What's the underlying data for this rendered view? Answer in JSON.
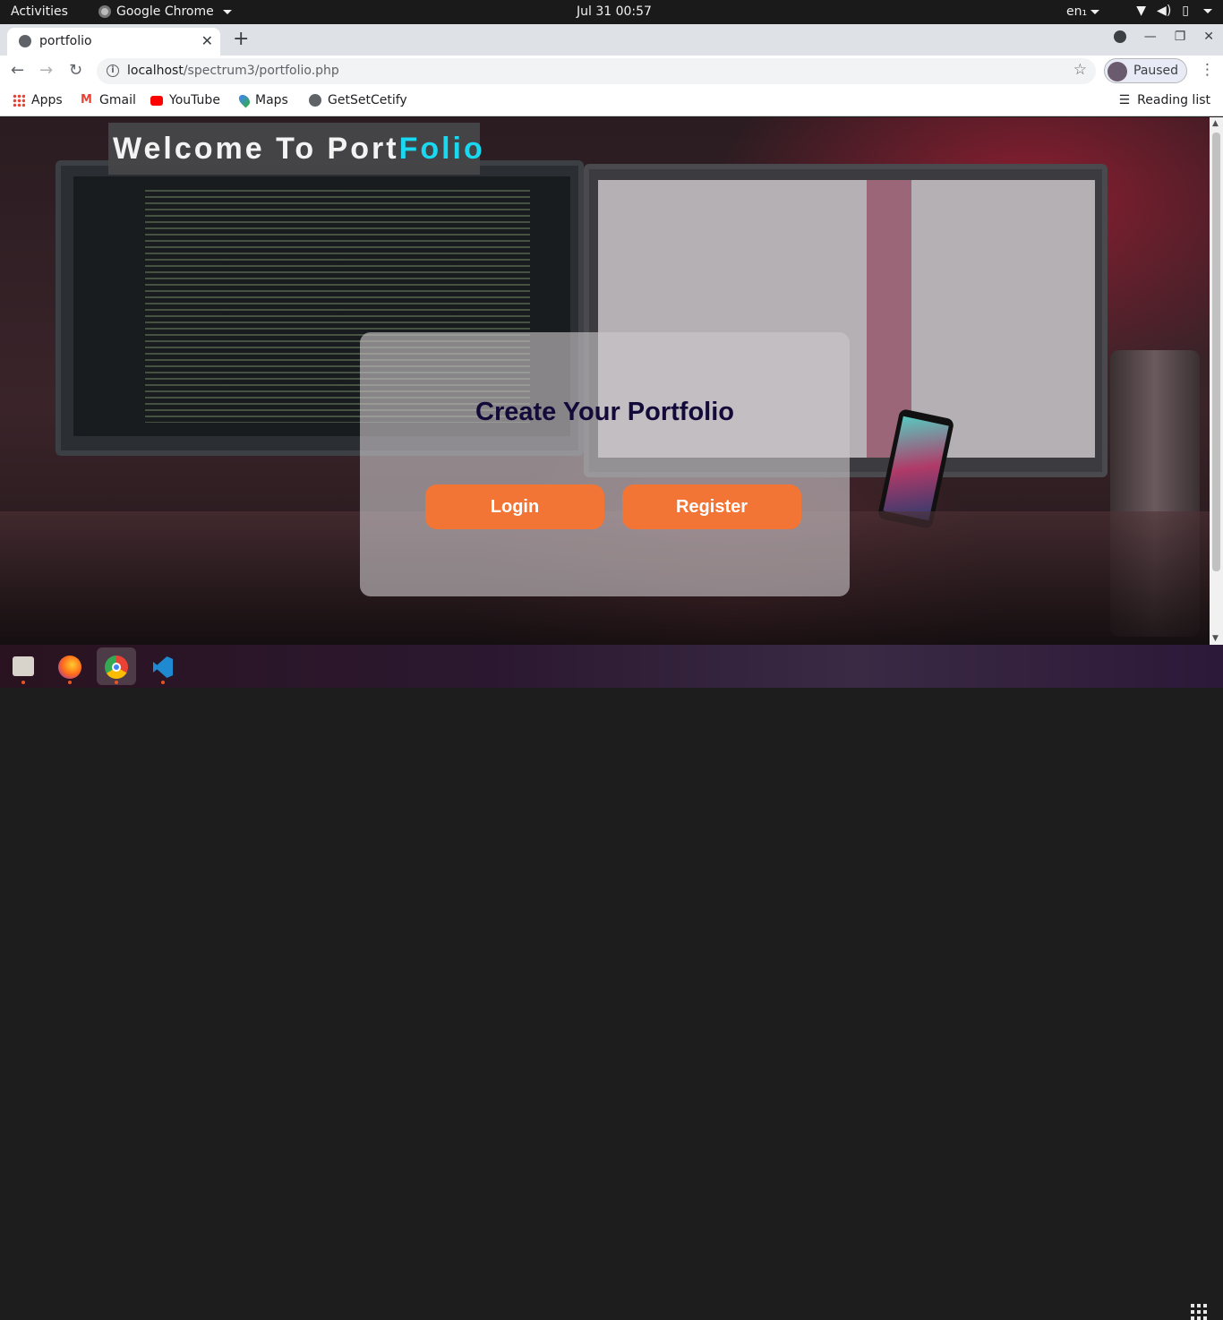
{
  "topbar": {
    "activities": "Activities",
    "app_menu": "Google Chrome",
    "clock": "Jul 31  00:57",
    "lang": "en₁"
  },
  "tab": {
    "title": "portfolio",
    "close": "✕",
    "new": "+"
  },
  "toolbar": {
    "url_host": "localhost",
    "url_path": "/spectrum3/portfolio.php",
    "profile_label": "Paused"
  },
  "bookmarks": [
    {
      "label": "Apps",
      "icon": "apps-grid-icon"
    },
    {
      "label": "Gmail",
      "icon": "gmail-icon"
    },
    {
      "label": "YouTube",
      "icon": "youtube-icon"
    },
    {
      "label": "Maps",
      "icon": "maps-icon"
    },
    {
      "label": "GetSetCetify",
      "icon": "globe-icon"
    }
  ],
  "reading_list": "Reading list",
  "page": {
    "heading_main": "Welcome To Port",
    "heading_accent": "Folio",
    "card_title": "Create Your Portfolio",
    "login": "Login",
    "register": "Register"
  },
  "colors": {
    "accent_cyan": "#19d8ef",
    "button_orange": "#f27535",
    "card_title": "#140a3a"
  },
  "dock": [
    "files-icon",
    "firefox-icon",
    "chrome-icon",
    "vscode-icon",
    "show-apps-icon"
  ]
}
